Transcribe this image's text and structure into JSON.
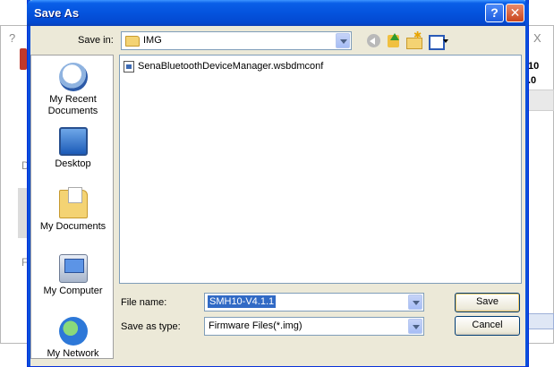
{
  "dialog": {
    "title": "Save As",
    "help_glyph": "?",
    "close_glyph": "✕"
  },
  "save_in": {
    "label": "Save in:",
    "value": "IMG"
  },
  "places": [
    {
      "label_line1": "My Recent",
      "label_line2": "Documents",
      "icon": "recent-documents-icon"
    },
    {
      "label_line1": "Desktop",
      "label_line2": "",
      "icon": "desktop-icon"
    },
    {
      "label_line1": "My Documents",
      "label_line2": "",
      "icon": "my-documents-icon"
    },
    {
      "label_line1": "My Computer",
      "label_line2": "",
      "icon": "my-computer-icon"
    },
    {
      "label_line1": "My Network",
      "label_line2": "",
      "icon": "my-network-icon"
    }
  ],
  "files": [
    {
      "name": "SenaBluetoothDeviceManager.wsbdmconf"
    }
  ],
  "file_name": {
    "label": "File name:",
    "value": "SMH10-V4.1.1"
  },
  "save_as_type": {
    "label": "Save as type:",
    "value": "Firmware Files(*.img)"
  },
  "buttons": {
    "save": "Save",
    "cancel": "Cancel"
  },
  "background": {
    "help": "?",
    "close": "X",
    "ver_line1": "10",
    "ver_line2": ".0",
    "letter_d": "D",
    "letter_f": "F"
  }
}
